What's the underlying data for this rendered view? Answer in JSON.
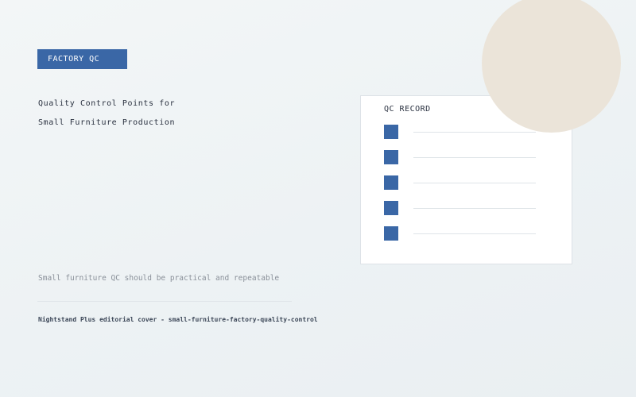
{
  "header": {
    "tag_label": "FACTORY QC",
    "title_lines": [
      "Quality Control Points for",
      "Small Furniture Production"
    ]
  },
  "subtitle": "Small furniture QC should be practical and repeatable",
  "footer": "Nightstand Plus editorial cover - small-furniture-factory-quality-control",
  "qc_card": {
    "title": "QC RECORD",
    "item_count": 5
  },
  "colors": {
    "accent": "#3a67a6",
    "decor_circle": "#ebe4d9",
    "text_dark": "#2a3140",
    "text_muted": "#8a9099"
  }
}
